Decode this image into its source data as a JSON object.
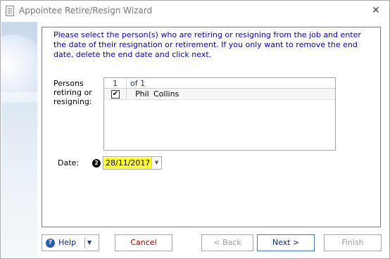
{
  "window": {
    "title": "Appointee Retire/Resign Wizard",
    "close_glyph": "✕"
  },
  "instructions": "Please select the person(s) who are retiring or resigning from the job and enter the date of their resignation or retirement.  If you only want to remove the end date, delete the end date and click next.",
  "persons": {
    "label": "Persons retiring or resigning:",
    "position": "1",
    "of_label": "of 1",
    "rows": [
      {
        "checked": "✔",
        "first_name": "Phil",
        "last_name": "Collins"
      }
    ]
  },
  "date": {
    "label": "Date:",
    "badge": "2",
    "value": "28/11/2017",
    "dropdown_glyph": "▼"
  },
  "buttons": {
    "help": "Help",
    "help_arrow": "▼",
    "cancel": "Cancel",
    "back": "< Back",
    "next": "Next  >",
    "finish": "Finish"
  },
  "colors": {
    "instructions": "#0000cc",
    "date_highlight": "#ffff33",
    "cancel": "#a40000"
  },
  "icons": {
    "app": "wizard-app-icon",
    "help": "help-icon",
    "close": "close-icon"
  }
}
